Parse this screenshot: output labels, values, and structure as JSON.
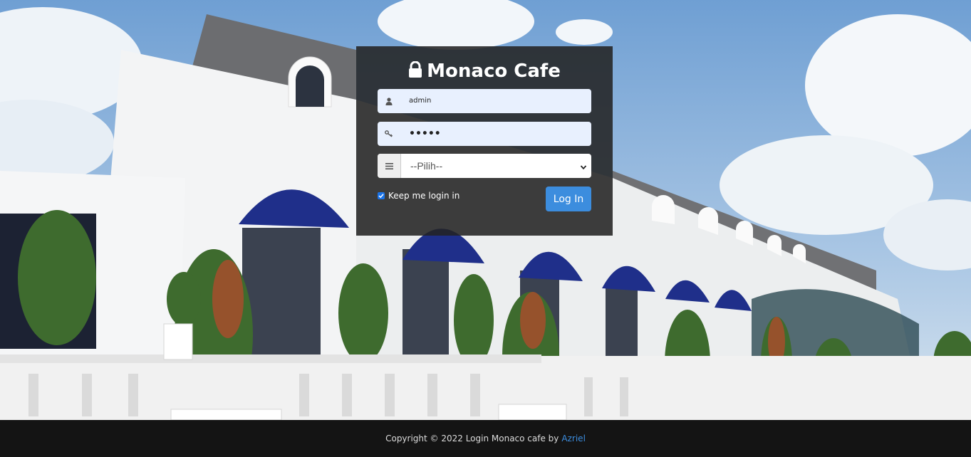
{
  "login": {
    "title": "Monaco Cafe",
    "username_value": "admin",
    "password_value": "•••••",
    "role_select_value": "--Pilih--",
    "remember_label": "Keep me login in",
    "remember_checked": true,
    "login_button": "Log In"
  },
  "footer": {
    "copyright_text": "Copyright © 2022 Login Monaco cafe by",
    "author_link": "Azriel"
  },
  "icons": {
    "title": "lock-icon",
    "username": "user-icon",
    "password": "key-icon",
    "select": "list-icon",
    "select_caret": "chevron-down-icon"
  },
  "colors": {
    "panel_bg": "#232323",
    "field_bg": "#e8f0fe",
    "button_bg": "#3c8dde",
    "footer_bg": "#141414",
    "link": "#3c8dde"
  }
}
